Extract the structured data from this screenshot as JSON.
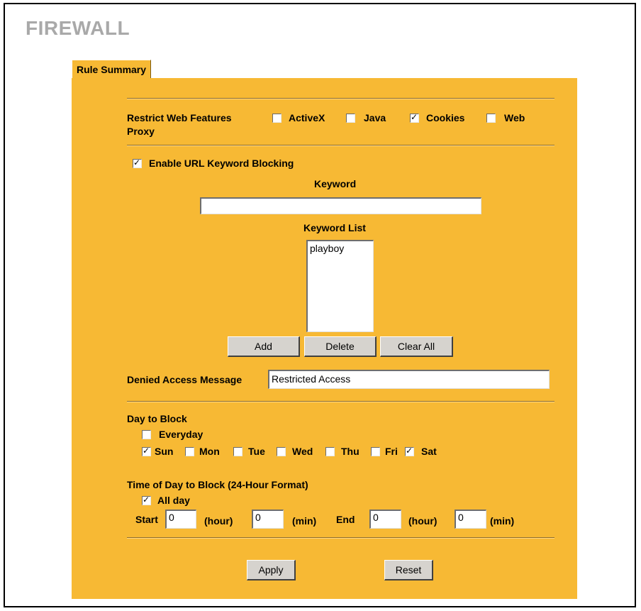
{
  "page_title": "FIREWALL",
  "tab_label": "Rule Summary",
  "restrict_web": {
    "label": "Restrict Web Features",
    "options": [
      {
        "label": "ActiveX",
        "checked": false
      },
      {
        "label": "Java",
        "checked": false
      },
      {
        "label": "Cookies",
        "checked": true
      },
      {
        "label": "Web",
        "checked": false
      }
    ],
    "wrap_label": "Proxy"
  },
  "url_blocking": {
    "enable_label": "Enable URL Keyword Blocking",
    "enabled": true,
    "keyword_label": "Keyword",
    "keyword_value": "",
    "list_label": "Keyword List",
    "list_items": [
      "playboy"
    ],
    "add_label": "Add",
    "delete_label": "Delete",
    "clear_label": "Clear All"
  },
  "denied": {
    "label": "Denied Access Message",
    "value": "Restricted Access"
  },
  "day_block": {
    "label": "Day to Block",
    "everyday_label": "Everyday",
    "everyday": false,
    "days": [
      {
        "label": "Sun",
        "checked": true
      },
      {
        "label": "Mon",
        "checked": false
      },
      {
        "label": "Tue",
        "checked": false
      },
      {
        "label": "Wed",
        "checked": false
      },
      {
        "label": "Thu",
        "checked": false
      },
      {
        "label": "Fri",
        "checked": false
      },
      {
        "label": "Sat",
        "checked": true
      }
    ]
  },
  "time_block": {
    "label": "Time of Day to Block (24-Hour Format)",
    "allday_label": "All day",
    "allday": true,
    "start_label": "Start",
    "end_label": "End",
    "hour_label": "(hour)",
    "min_label": "(min)",
    "start_hour": "0",
    "start_min": "0",
    "end_hour": "0",
    "end_min": "0"
  },
  "actions": {
    "apply_label": "Apply",
    "reset_label": "Reset"
  }
}
